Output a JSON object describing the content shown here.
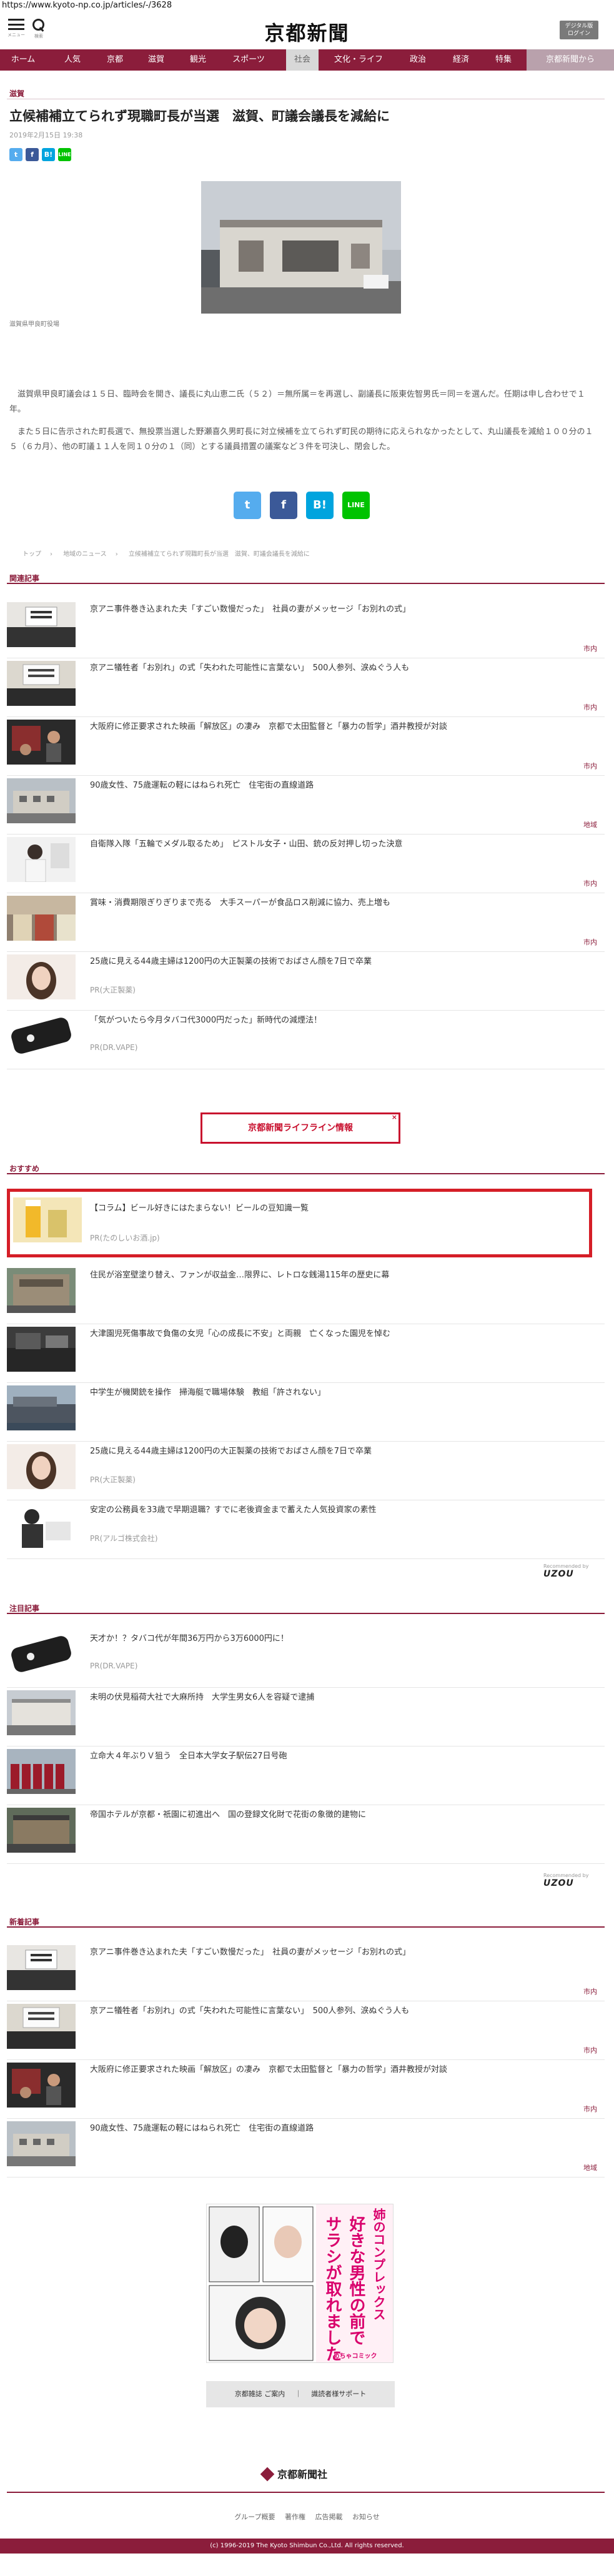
{
  "browser": {
    "url": "https://www.kyoto-np.co.jp/articles/-/3628"
  },
  "header": {
    "menu_caption": "メニュー",
    "search_caption": "検索",
    "logo": "京都新聞",
    "login_label_1": "デジタル版",
    "login_label_2": "ログイン"
  },
  "nav": {
    "items": [
      "ホーム",
      "人気",
      "京都",
      "滋賀",
      "観光",
      "スポーツ",
      "社会",
      "文化・ライフ",
      "政治",
      "経済",
      "特集",
      "京都新聞から"
    ],
    "active": "社会"
  },
  "article": {
    "category": "滋賀",
    "title": "立候補補立てられず現職町長が当選　滋賀、町議会議長を減給に",
    "date": "2019年2月15日 19:38",
    "caption": "滋賀県甲良町役場",
    "body_1": "　滋賀県甲良町議会は１５日、臨時会を開き、議長に丸山恵二氏（５２）＝無所属＝を再選し、副議長に阪東佐智男氏＝同＝を選んだ。任期は申し合わせで１年。",
    "body_2": "　また５日に告示された町長選で、無投票当選した野瀬喜久男町長に対立候補を立てられず町民の期待に応えられなかったとして、丸山議長を減給１００分の１５（６カ月）、他の町議１１人を同１０分の１（同）とする議員措置の議案など３件を可決し、閉会した。"
  },
  "share": {
    "twitter": "t",
    "facebook": "f",
    "hatena": "B!",
    "line": "LINE"
  },
  "breadcrumb": [
    "トップ",
    "地域のニュース",
    "立候補補立てられず現職町長が当選　滋賀、町議会議長を減給に"
  ],
  "related": {
    "heading": "関連記事",
    "items": [
      {
        "title": "京アニ事件巻き込まれた夫「すごい数慢だった」　社員の妻がメッセージ「お別れの式」",
        "tag": "市内"
      },
      {
        "title": "京アニ犠牲者「お別れ」の式「失われた可能性に言葉ない」　500人参列、涙ぬぐう人も",
        "tag": "市内"
      },
      {
        "title": "大阪府に修正要求された映画「解放区」の凄み　京都で太田監督と「暴力の哲学」酒井教授が対談",
        "tag": "市内"
      },
      {
        "title": "90歳女性、75歳運転の軽にはねられ死亡　住宅街の直線道路",
        "tag": "地域"
      },
      {
        "title": "自衛隊入隊「五輪でメダル取るため」　ピストル女子・山田、銃の反対押し切った決意",
        "tag": "市内"
      },
      {
        "title": "賞味・消費期限ぎりぎりまで売る　大手スーパーが食品ロス削減に協力、売上増も",
        "tag": "市内"
      },
      {
        "title": "25歳に見える44歳主婦は1200円の大正製薬の技術でおばさん顔を7日で卒業",
        "pr": "PR(大正製薬)"
      },
      {
        "title": "「気がついたら今月タバコ代3000円だった」新時代の減煙法！",
        "pr": "PR(DR.VAPE)"
      }
    ]
  },
  "lifeline": {
    "label": "京都新聞ライフライン情報",
    "close": "×"
  },
  "recommend": {
    "heading": "おすすめ",
    "items": [
      {
        "title": "【コラム】ビール好きにはたまらない！ビールの豆知識一覧",
        "pr": "PR(たのしいお酒.jp)"
      },
      {
        "title": "住民が浴室壁塗り替え、ファンが収益金…限界に、レトロな銭湯115年の歴史に幕"
      },
      {
        "title": "大津園児死傷事故で負傷の女児「心の成長に不安」と両親　亡くなった園児を悼む"
      },
      {
        "title": "中学生が機関銃を操作　掃海艇で職場体験　教組「許されない」"
      },
      {
        "title": "25歳に見える44歳主婦は1200円の大正製薬の技術でおばさん顔を7日で卒業",
        "pr": "PR(大正製薬)"
      },
      {
        "title": "安定の公務員を33歳で早期退職？すでに老後資金まで蓄えた人気投資家の素性",
        "pr": "PR(アルゴ株式会社)"
      }
    ],
    "powered_prefix": "Recommended by",
    "powered_brand": "UZOU"
  },
  "notable": {
    "heading": "注目記事",
    "items": [
      {
        "title": "天才か！？タバコ代が年間36万円から3万6000円に！",
        "pr": "PR(DR.VAPE)"
      },
      {
        "title": "未明の伏見稲荷大社で大麻所持　大学生男女6人を容疑で逮捕"
      },
      {
        "title": "立命大４年ぶりＶ狙う　全日本大学女子駅伝27日号砲"
      },
      {
        "title": "帝国ホテルが京都・祇園に初進出へ　国の登録文化財で花街の象徴的建物に"
      }
    ],
    "powered_prefix": "Recommended by",
    "powered_brand": "UZOU"
  },
  "latest": {
    "heading": "新着記事",
    "items": [
      {
        "title": "京アニ事件巻き込まれた夫「すごい数慢だった」　社員の妻がメッセージ「お別れの式」",
        "tag": "市内"
      },
      {
        "title": "京アニ犠牲者「お別れ」の式「失われた可能性に言葉ない」　500人参列、涙ぬぐう人も",
        "tag": "市内"
      },
      {
        "title": "大阪府に修正要求された映画「解放区」の凄み　京都で太田監督と「暴力の哲学」酒井教授が対談",
        "tag": "市内"
      },
      {
        "title": "90歳女性、75歳運転の軽にはねられ死亡　住宅街の直線道路",
        "tag": "地域"
      }
    ]
  },
  "ad": {
    "line1": "好きな男性の前で",
    "line2": "サラシが取れました",
    "line3": "姉のコンプレックス",
    "tag": "めちゃコミック"
  },
  "bottom_buttons": [
    "京都雑誌 ご案内",
    "｜",
    "識読者様サポート"
  ],
  "footer": {
    "logo": "京都新聞社",
    "links": [
      "グループ概要",
      "著作権",
      "広告掲載",
      "お知らせ"
    ],
    "copyright": "(c) 1996-2019 The Kyoto Shimbun Co.,Ltd. All rights reserved."
  },
  "colors": {
    "brand": "#8b1d3b",
    "highlight": "#d51e27",
    "twitter": "#55acee",
    "facebook": "#3b5998",
    "hatena": "#00a4de",
    "line": "#00c300"
  }
}
